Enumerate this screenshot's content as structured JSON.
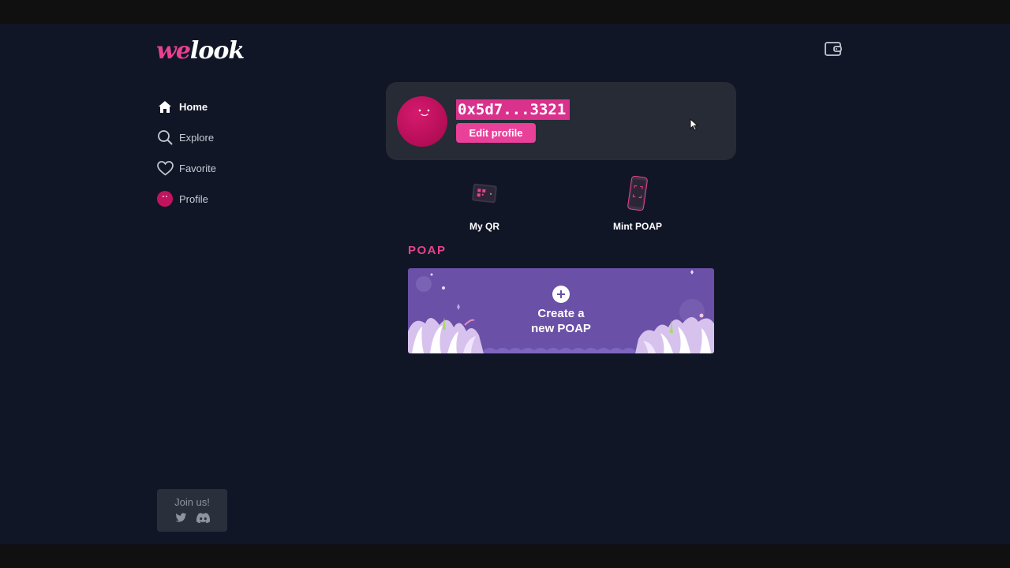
{
  "app": {
    "logo_part1": "we",
    "logo_part2": "look",
    "wallet_icon": "wallet-icon"
  },
  "sidebar": {
    "items": [
      {
        "label": "Home",
        "icon": "home-icon",
        "active": true
      },
      {
        "label": "Explore",
        "icon": "search-icon",
        "active": false
      },
      {
        "label": "Favorite",
        "icon": "heart-icon",
        "active": false
      },
      {
        "label": "Profile",
        "icon": "avatar-icon",
        "active": false
      }
    ],
    "join": {
      "title": "Join us!",
      "socials": [
        "twitter-icon",
        "discord-icon"
      ]
    }
  },
  "profile": {
    "address": "0x5d7...3321",
    "edit_label": "Edit profile"
  },
  "actions": [
    {
      "label": "My QR",
      "icon": "qr-card-icon"
    },
    {
      "label": "Mint POAP",
      "icon": "phone-scan-icon"
    }
  ],
  "poap": {
    "section_title": "POAP",
    "create_line1": "Create a",
    "create_line2": "new POAP"
  },
  "colors": {
    "background": "#111627",
    "card": "#262b36",
    "accent_pink": "#e8418f",
    "avatar": "#c2135f",
    "poap_card": "#6a50a7"
  }
}
